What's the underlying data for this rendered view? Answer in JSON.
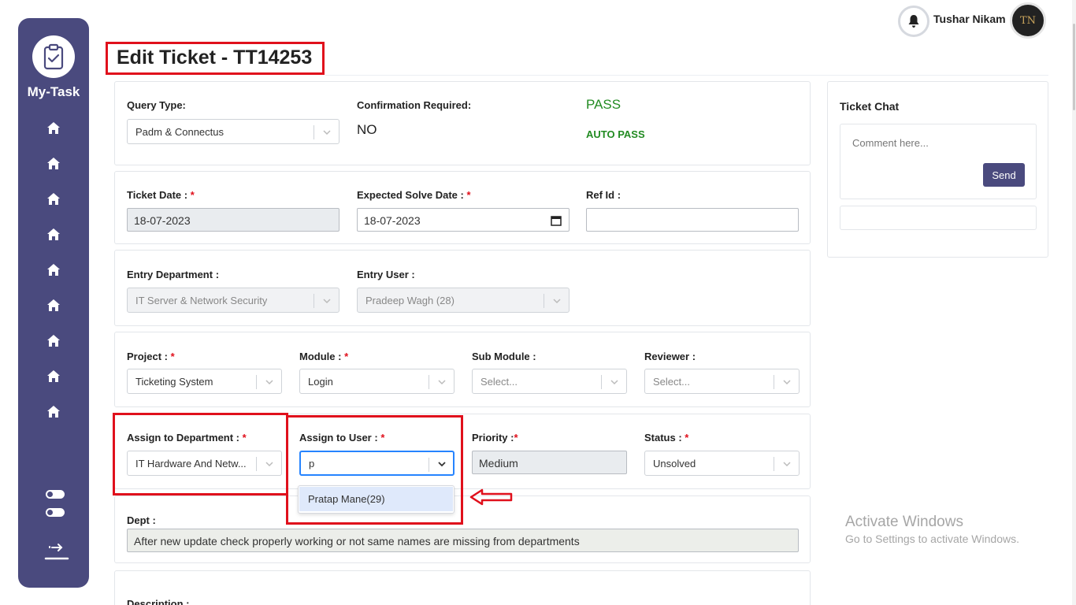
{
  "app": {
    "name": "My-Task"
  },
  "sidebar": {
    "nav_count": 9
  },
  "header": {
    "user_name": "Tushar Nikam",
    "avatar_initials": "TN"
  },
  "page": {
    "title": "Edit Ticket - TT14253"
  },
  "query": {
    "type_label": "Query Type:",
    "type_value": "Padm & Connectus",
    "confirmation_label": "Confirmation Required:",
    "confirmation_value": "NO",
    "pass_status": "PASS",
    "auto_pass": "AUTO PASS"
  },
  "dates": {
    "ticket_date_label": "Ticket Date :",
    "ticket_date": "18-07-2023",
    "expected_label": "Expected Solve Date :",
    "expected_date": "18-07-2023",
    "ref_label": "Ref Id :",
    "ref_value": ""
  },
  "entry": {
    "dept_label": "Entry Department :",
    "dept_value": "IT Server & Network Security",
    "user_label": "Entry User :",
    "user_value": "Pradeep Wagh (28)"
  },
  "project": {
    "project_label": "Project :",
    "project_value": "Ticketing System",
    "module_label": "Module :",
    "module_value": "Login",
    "submodule_label": "Sub Module :",
    "submodule_placeholder": "Select...",
    "reviewer_label": "Reviewer :",
    "reviewer_placeholder": "Select..."
  },
  "assign": {
    "dept_label": "Assign to Department :",
    "dept_value": "IT Hardware And Netw...",
    "user_label": "Assign to User :",
    "user_input": "p",
    "priority_label": "Priority :",
    "priority_value": "Medium",
    "status_label": "Status :",
    "status_value": "Unsolved",
    "dropdown_option": "Pratap Mane(29)"
  },
  "dept": {
    "label": "Dept :",
    "value": "After new update check properly working or not same names are missing from departments"
  },
  "description": {
    "label": "Description :"
  },
  "chat": {
    "title": "Ticket Chat",
    "placeholder": "Comment here...",
    "send_label": "Send"
  },
  "watermark": {
    "line1": "Activate Windows",
    "line2": "Go to Settings to activate Windows."
  },
  "colors": {
    "sidebar": "#4a4a7e",
    "annotation_red": "#e0101c",
    "pass_green": "#228b22"
  }
}
